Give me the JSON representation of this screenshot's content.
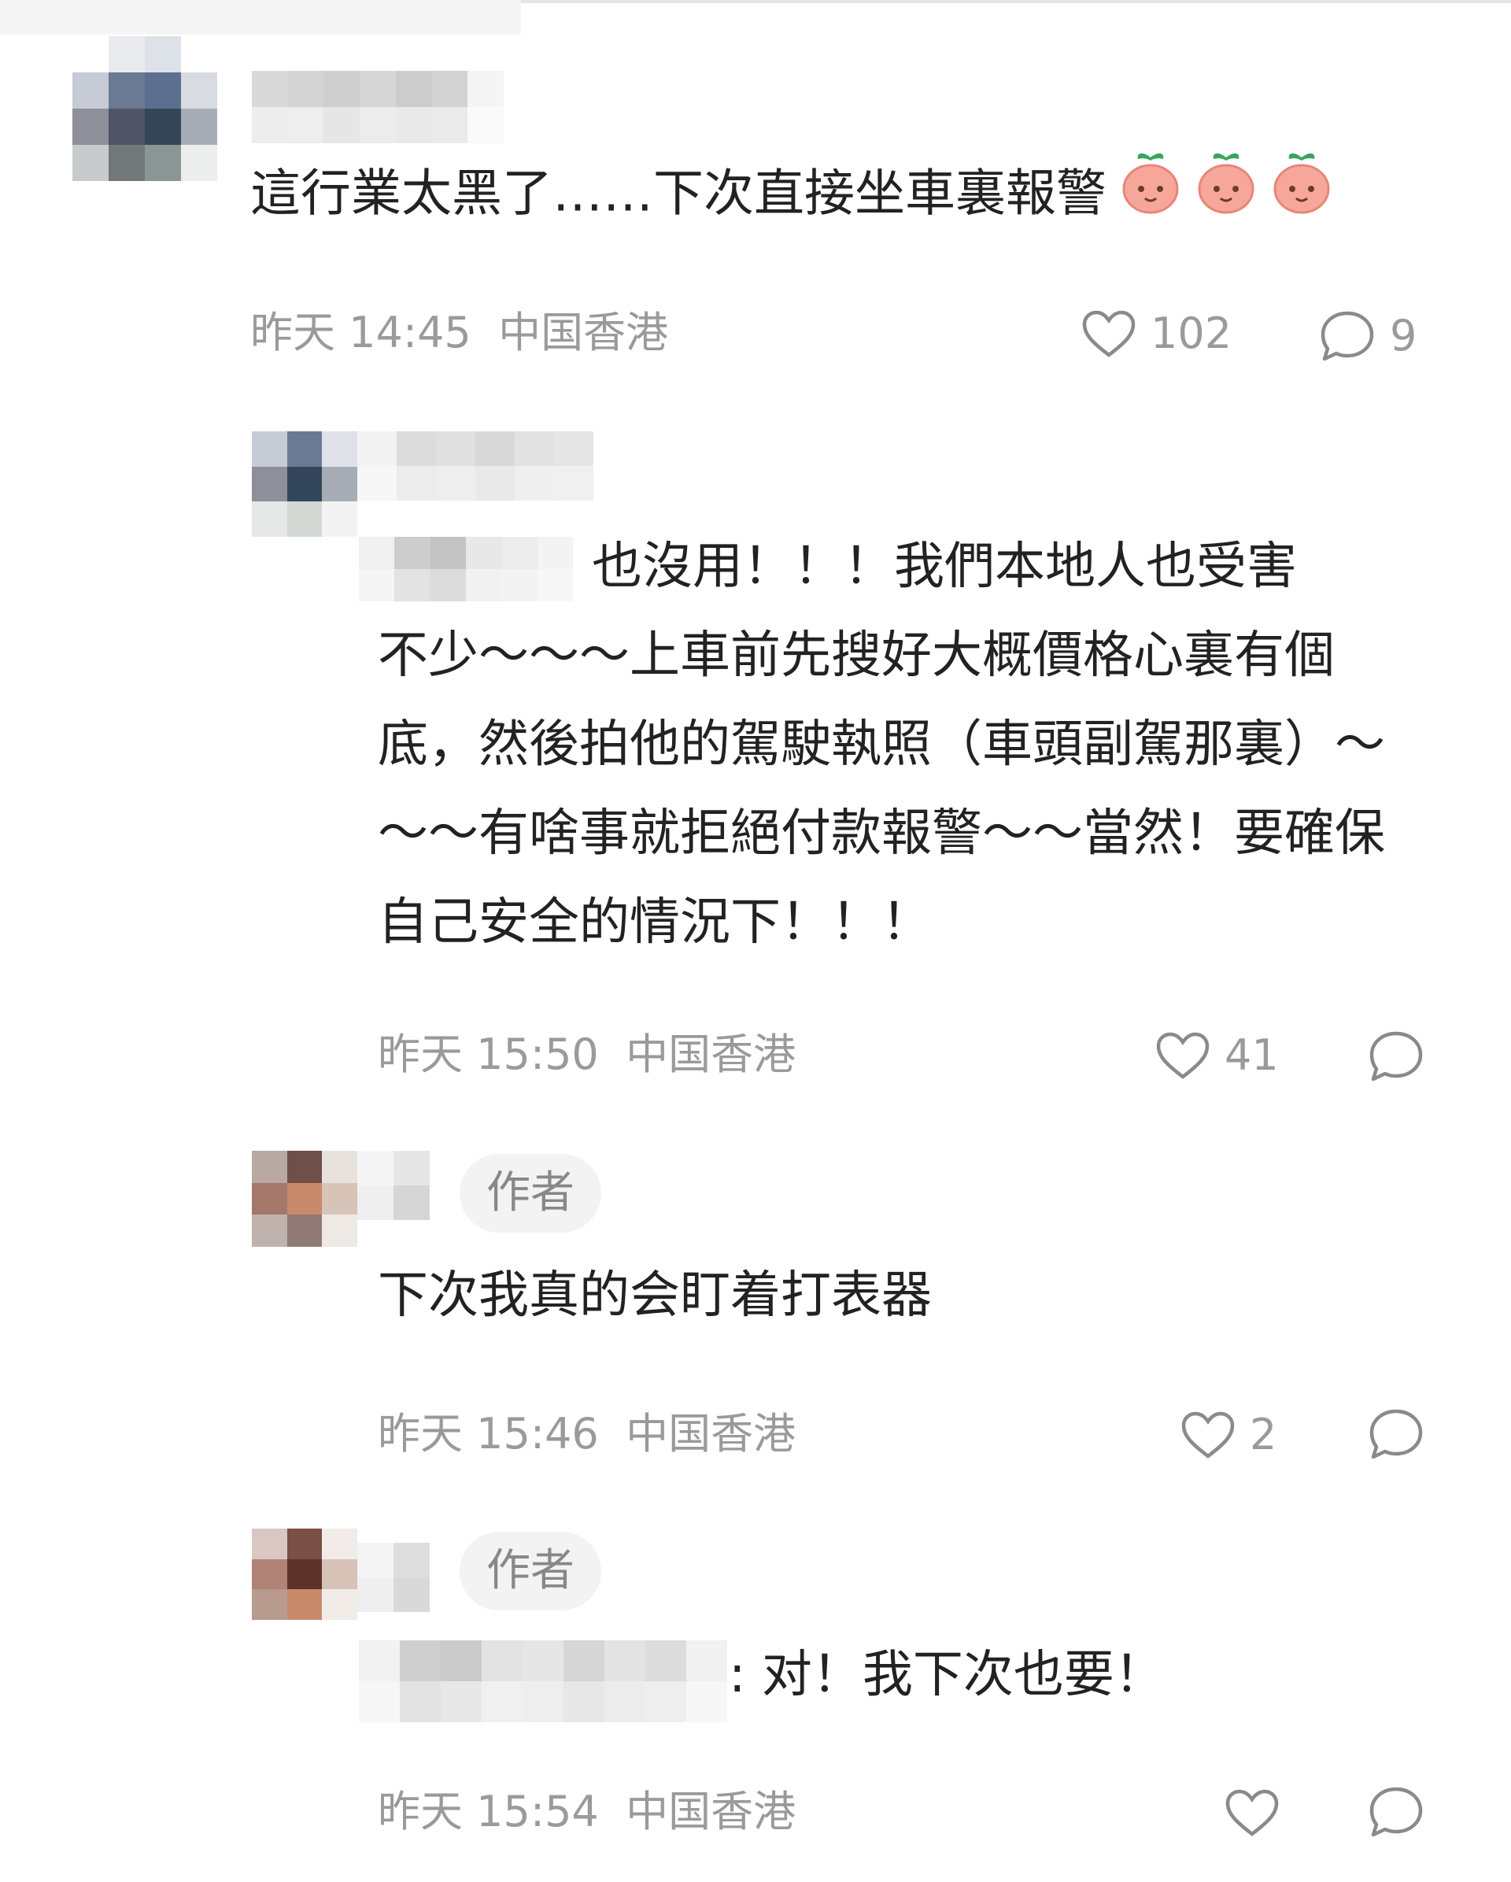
{
  "comments": [
    {
      "text": "這行業太黑了……下次直接坐車裏報警",
      "emoji_icon": "peach-face-emoji",
      "emoji_count": 3,
      "time": "昨天 14:45",
      "location": "中国香港",
      "likes": "102",
      "replies": "9"
    }
  ],
  "replies": [
    {
      "text_line1": "也沒用！！！我們本地人也受害",
      "text_rest": "不少～～～上車前先搜好大概價格心裏有個底，然後拍他的駕駛執照（車頭副駕那裏）～～～有啥事就拒絕付款報警～～當然！要確保自己安全的情況下！！！",
      "time": "昨天 15:50",
      "location": "中国香港",
      "likes": "41"
    },
    {
      "badge": "作者",
      "text": "下次我真的会盯着打表器",
      "time": "昨天 15:46",
      "location": "中国香港",
      "likes": "2"
    },
    {
      "badge": "作者",
      "text": ": 对！我下次也要！",
      "time": "昨天 15:54",
      "location": "中国香港"
    }
  ],
  "icons": {
    "like": "heart-outline-icon",
    "comment": "chat-bubble-icon"
  },
  "colors": {
    "text": "#222222",
    "meta": "#9a9a9a",
    "badge_bg": "#f3f3f3"
  }
}
